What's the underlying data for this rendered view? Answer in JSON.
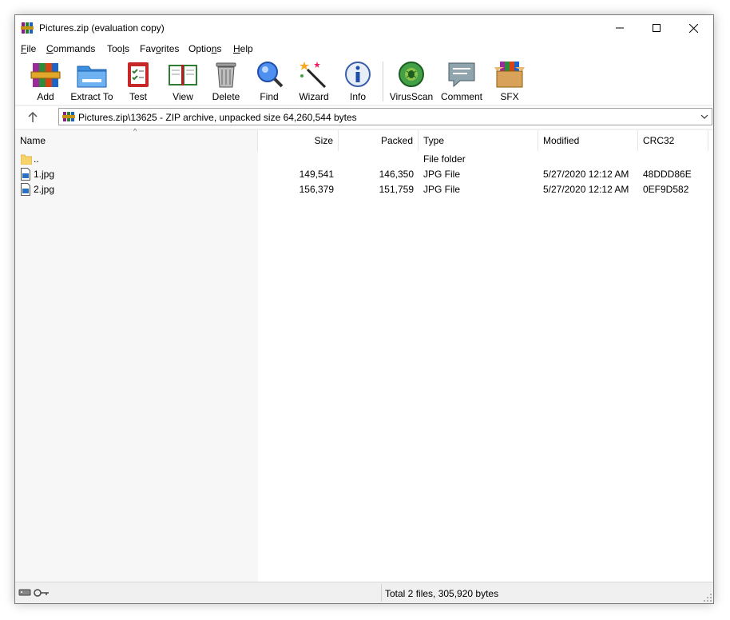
{
  "window": {
    "title": "Pictures.zip (evaluation copy)"
  },
  "menu": [
    {
      "pre": "",
      "acc": "F",
      "post": "ile"
    },
    {
      "pre": "",
      "acc": "C",
      "post": "ommands"
    },
    {
      "pre": "Too",
      "acc": "l",
      "post": "s"
    },
    {
      "pre": "Fav",
      "acc": "o",
      "post": "rites"
    },
    {
      "pre": "Optio",
      "acc": "n",
      "post": "s"
    },
    {
      "pre": "",
      "acc": "H",
      "post": "elp"
    }
  ],
  "toolbar": {
    "add": "Add",
    "extract_to": "Extract To",
    "test": "Test",
    "view": "View",
    "delete": "Delete",
    "find": "Find",
    "wizard": "Wizard",
    "info": "Info",
    "virusscan": "VirusScan",
    "comment": "Comment",
    "sfx": "SFX"
  },
  "address": {
    "path": "Pictures.zip\\13625 - ZIP archive, unpacked size 64,260,544 bytes"
  },
  "columns": {
    "name": "Name",
    "size": "Size",
    "packed": "Packed",
    "type": "Type",
    "modified": "Modified",
    "crc": "CRC32"
  },
  "files": [
    {
      "name": "..",
      "size": "",
      "packed": "",
      "type": "File folder",
      "modified": "",
      "crc": "",
      "icon": "folder-icon"
    },
    {
      "name": "1.jpg",
      "size": "149,541",
      "packed": "146,350",
      "type": "JPG File",
      "modified": "5/27/2020 12:12 AM",
      "crc": "48DDD86E",
      "icon": "jpg-file-icon"
    },
    {
      "name": "2.jpg",
      "size": "156,379",
      "packed": "151,759",
      "type": "JPG File",
      "modified": "5/27/2020 12:12 AM",
      "crc": "0EF9D582",
      "icon": "jpg-file-icon"
    }
  ],
  "status": {
    "summary": "Total 2 files, 305,920 bytes"
  }
}
